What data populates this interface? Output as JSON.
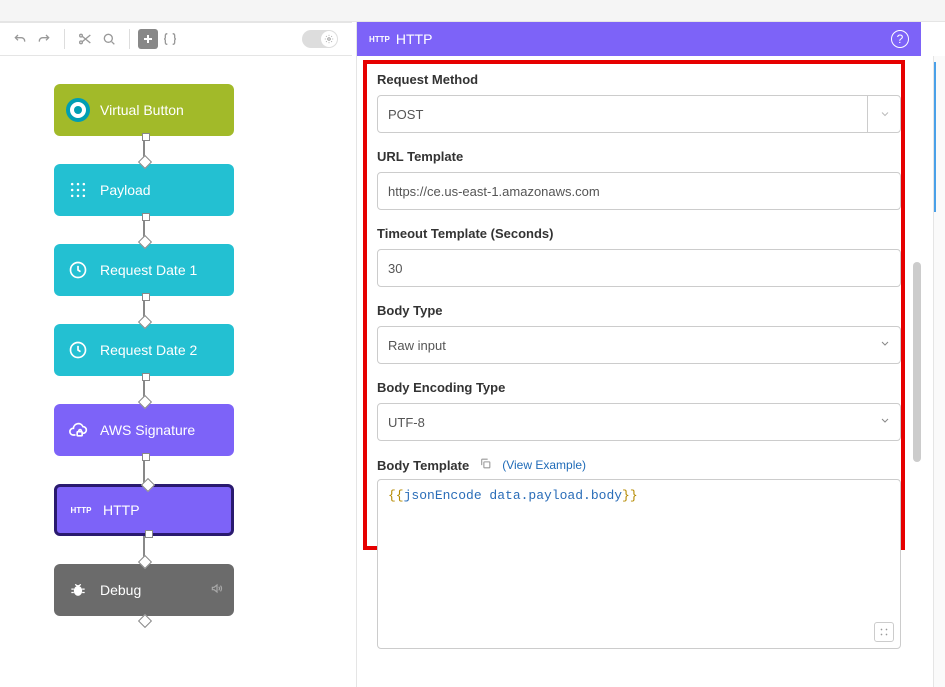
{
  "toolbar": {},
  "nodes": {
    "virtual_button": "Virtual Button",
    "payload": "Payload",
    "request_date_1": "Request Date 1",
    "request_date_2": "Request Date 2",
    "aws_signature": "AWS Signature",
    "http": "HTTP",
    "debug": "Debug"
  },
  "panel": {
    "title": "HTTP",
    "http_tag": "HTTP",
    "request_method_label": "Request Method",
    "request_method_value": "POST",
    "url_label": "URL Template",
    "url_value": "https://ce.us-east-1.amazonaws.com",
    "timeout_label": "Timeout Template (Seconds)",
    "timeout_value": "30",
    "body_type_label": "Body Type",
    "body_type_value": "Raw input",
    "body_encoding_label": "Body Encoding Type",
    "body_encoding_value": "UTF-8",
    "body_template_label": "Body Template",
    "view_example": "(View Example)",
    "body_template_code_open": "{{",
    "body_template_code_ident": "jsonEncode data.payload.body",
    "body_template_code_close": "}}"
  }
}
